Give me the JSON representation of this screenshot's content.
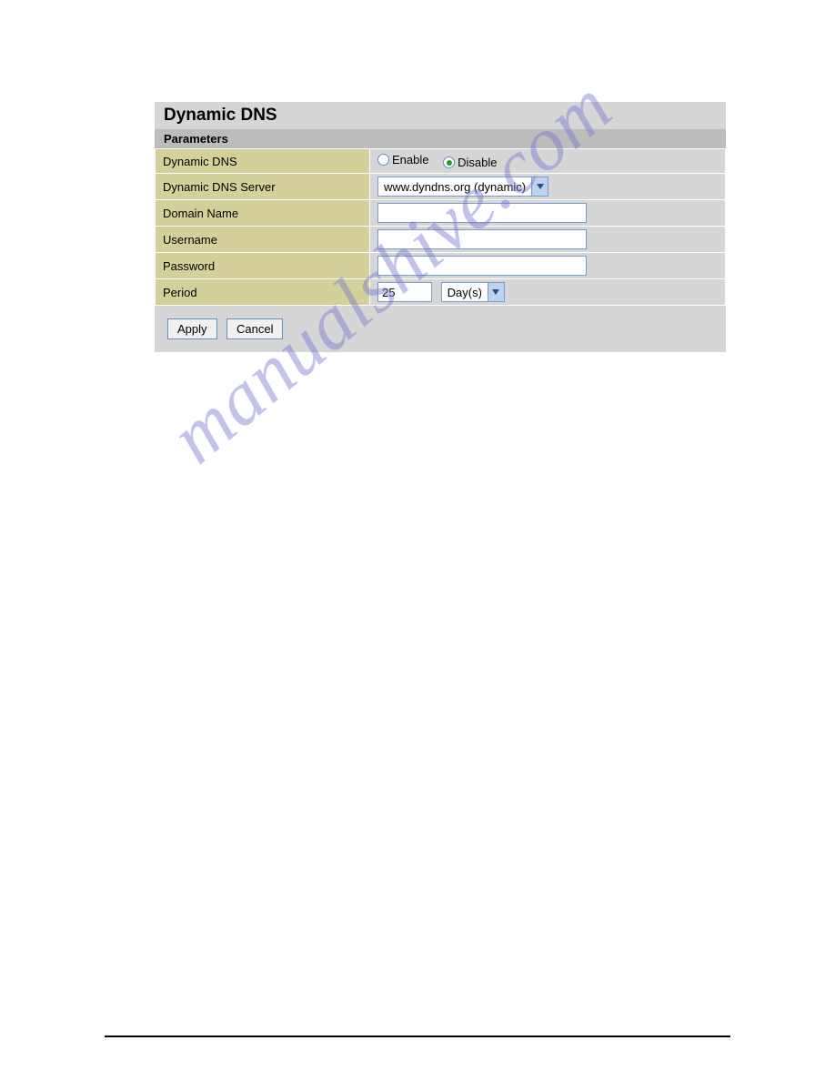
{
  "header": {
    "title": "Dynamic DNS",
    "subhead": "Parameters"
  },
  "rows": {
    "ddns": {
      "label": "Dynamic DNS",
      "enable_label": "Enable",
      "disable_label": "Disable",
      "selected": "disable"
    },
    "server": {
      "label": "Dynamic DNS Server",
      "value": "www.dyndns.org (dynamic)"
    },
    "domain": {
      "label": "Domain Name",
      "value": ""
    },
    "username": {
      "label": "Username",
      "value": ""
    },
    "password": {
      "label": "Password",
      "value": ""
    },
    "period": {
      "label": "Period",
      "value": "25",
      "unit": "Day(s)"
    }
  },
  "buttons": {
    "apply": "Apply",
    "cancel": "Cancel"
  },
  "watermark": "manualshive.com"
}
